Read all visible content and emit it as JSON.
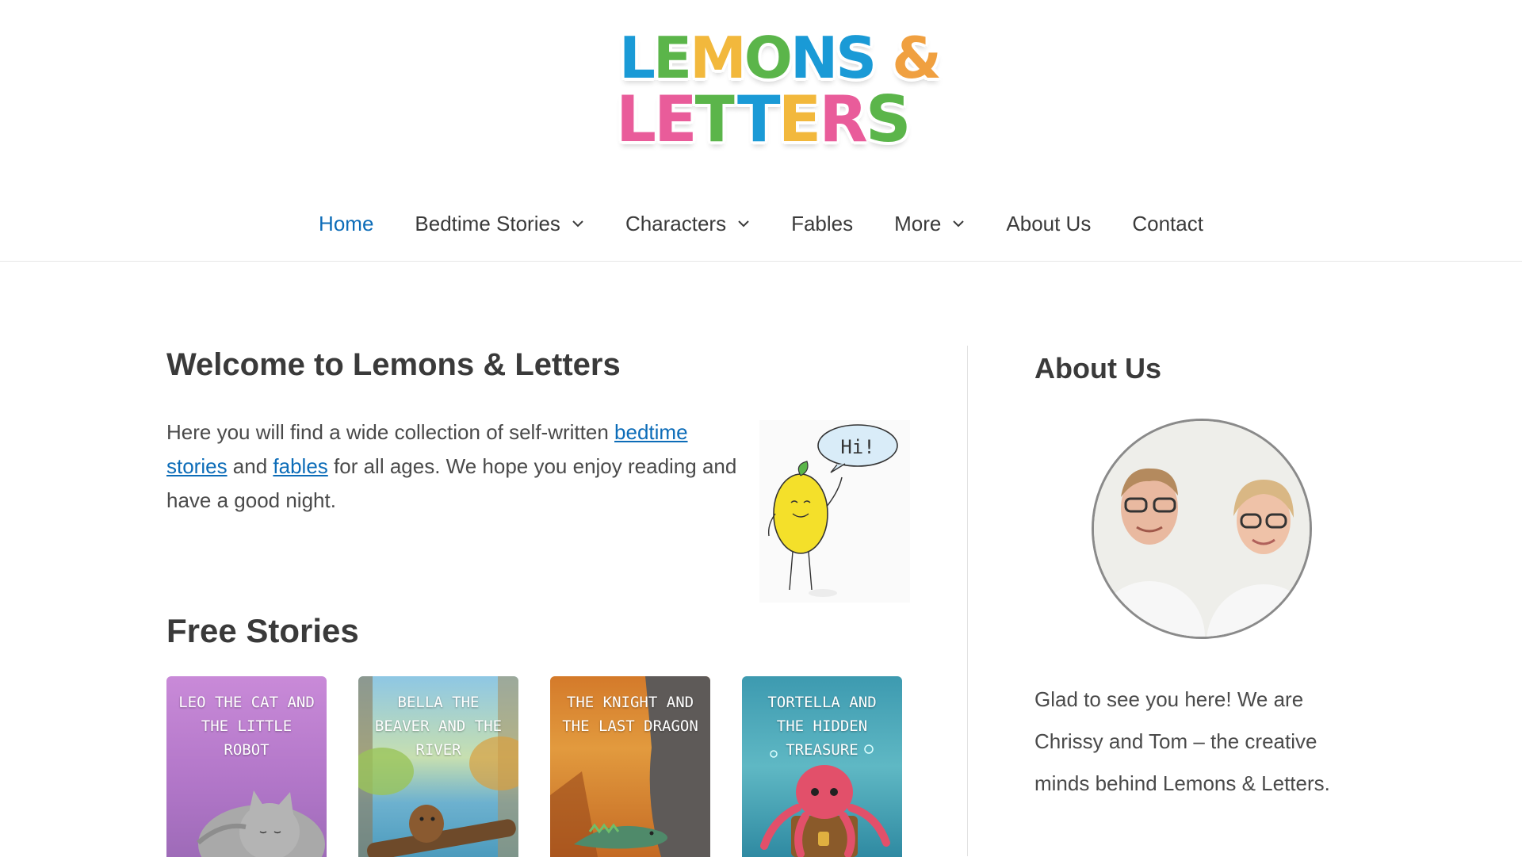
{
  "site": {
    "logo_line1": "LEMONS &",
    "logo_line2": "LETTERS"
  },
  "nav": {
    "items": [
      {
        "label": "Home",
        "active": true,
        "has_dropdown": false
      },
      {
        "label": "Bedtime Stories",
        "active": false,
        "has_dropdown": true
      },
      {
        "label": "Characters",
        "active": false,
        "has_dropdown": true
      },
      {
        "label": "Fables",
        "active": false,
        "has_dropdown": false
      },
      {
        "label": "More",
        "active": false,
        "has_dropdown": true
      },
      {
        "label": "About Us",
        "active": false,
        "has_dropdown": false
      },
      {
        "label": "Contact",
        "active": false,
        "has_dropdown": false
      }
    ]
  },
  "main": {
    "welcome_title": "Welcome to Lemons & Letters",
    "intro": {
      "before": "Here you will find a wide collection of self-written ",
      "link1": "bedtime stories",
      "middle": " and ",
      "link2": "fables",
      "after": " for all ages. We hope you enjoy reading and have a good night."
    },
    "lemon_speech": "Hi!",
    "free_stories_title": "Free Stories",
    "books": [
      {
        "title": "Leo the Cat and the Little Robot"
      },
      {
        "title": "Bella the Beaver and the River"
      },
      {
        "title": "The Knight and the Last Dragon"
      },
      {
        "title": "Tortella and the Hidden Treasure"
      }
    ]
  },
  "sidebar": {
    "about_title": "About Us",
    "about_text": "Glad to see you here! We are Chrissy and Tom – the creative minds behind Lemons & Letters."
  },
  "colors": {
    "link": "#0c6cb8",
    "text": "#3a3a3a",
    "logo_blue": "#1a9ad6",
    "logo_green": "#5bb54a",
    "logo_yellow": "#f2b83c",
    "logo_orange": "#f0a040",
    "logo_pink": "#e95c9a"
  }
}
